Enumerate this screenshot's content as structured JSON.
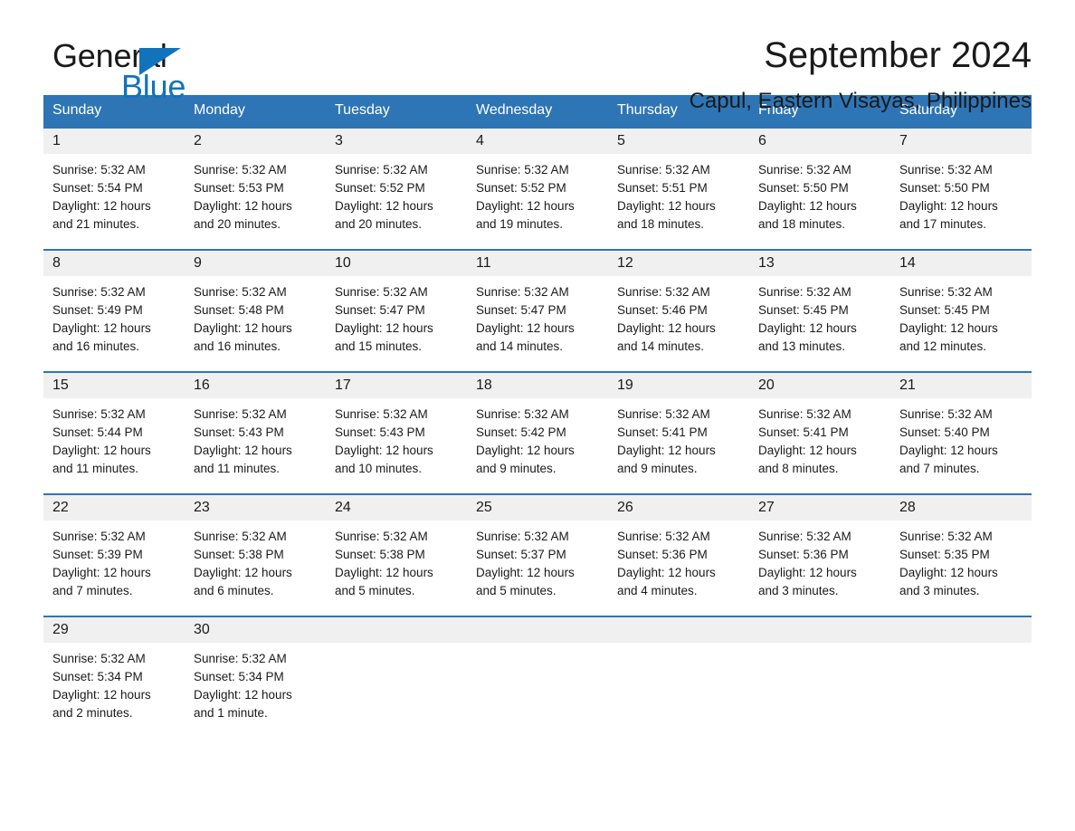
{
  "brand": {
    "name_part1": "General",
    "name_part2": "Blue",
    "logo_icon": "triangle-icon",
    "accent_color": "#1173bb"
  },
  "header": {
    "month_title": "September 2024",
    "location": "Capul, Eastern Visayas, Philippines"
  },
  "theme": {
    "header_blue": "#2e75b6",
    "daynum_gray": "#f0f0f0",
    "text": "#1a1a1a"
  },
  "calendar": {
    "weekday_headers": [
      "Sunday",
      "Monday",
      "Tuesday",
      "Wednesday",
      "Thursday",
      "Friday",
      "Saturday"
    ],
    "weeks": [
      [
        {
          "day": "1",
          "sunrise": "Sunrise: 5:32 AM",
          "sunset": "Sunset: 5:54 PM",
          "daylight_line1": "Daylight: 12 hours",
          "daylight_line2": "and 21 minutes."
        },
        {
          "day": "2",
          "sunrise": "Sunrise: 5:32 AM",
          "sunset": "Sunset: 5:53 PM",
          "daylight_line1": "Daylight: 12 hours",
          "daylight_line2": "and 20 minutes."
        },
        {
          "day": "3",
          "sunrise": "Sunrise: 5:32 AM",
          "sunset": "Sunset: 5:52 PM",
          "daylight_line1": "Daylight: 12 hours",
          "daylight_line2": "and 20 minutes."
        },
        {
          "day": "4",
          "sunrise": "Sunrise: 5:32 AM",
          "sunset": "Sunset: 5:52 PM",
          "daylight_line1": "Daylight: 12 hours",
          "daylight_line2": "and 19 minutes."
        },
        {
          "day": "5",
          "sunrise": "Sunrise: 5:32 AM",
          "sunset": "Sunset: 5:51 PM",
          "daylight_line1": "Daylight: 12 hours",
          "daylight_line2": "and 18 minutes."
        },
        {
          "day": "6",
          "sunrise": "Sunrise: 5:32 AM",
          "sunset": "Sunset: 5:50 PM",
          "daylight_line1": "Daylight: 12 hours",
          "daylight_line2": "and 18 minutes."
        },
        {
          "day": "7",
          "sunrise": "Sunrise: 5:32 AM",
          "sunset": "Sunset: 5:50 PM",
          "daylight_line1": "Daylight: 12 hours",
          "daylight_line2": "and 17 minutes."
        }
      ],
      [
        {
          "day": "8",
          "sunrise": "Sunrise: 5:32 AM",
          "sunset": "Sunset: 5:49 PM",
          "daylight_line1": "Daylight: 12 hours",
          "daylight_line2": "and 16 minutes."
        },
        {
          "day": "9",
          "sunrise": "Sunrise: 5:32 AM",
          "sunset": "Sunset: 5:48 PM",
          "daylight_line1": "Daylight: 12 hours",
          "daylight_line2": "and 16 minutes."
        },
        {
          "day": "10",
          "sunrise": "Sunrise: 5:32 AM",
          "sunset": "Sunset: 5:47 PM",
          "daylight_line1": "Daylight: 12 hours",
          "daylight_line2": "and 15 minutes."
        },
        {
          "day": "11",
          "sunrise": "Sunrise: 5:32 AM",
          "sunset": "Sunset: 5:47 PM",
          "daylight_line1": "Daylight: 12 hours",
          "daylight_line2": "and 14 minutes."
        },
        {
          "day": "12",
          "sunrise": "Sunrise: 5:32 AM",
          "sunset": "Sunset: 5:46 PM",
          "daylight_line1": "Daylight: 12 hours",
          "daylight_line2": "and 14 minutes."
        },
        {
          "day": "13",
          "sunrise": "Sunrise: 5:32 AM",
          "sunset": "Sunset: 5:45 PM",
          "daylight_line1": "Daylight: 12 hours",
          "daylight_line2": "and 13 minutes."
        },
        {
          "day": "14",
          "sunrise": "Sunrise: 5:32 AM",
          "sunset": "Sunset: 5:45 PM",
          "daylight_line1": "Daylight: 12 hours",
          "daylight_line2": "and 12 minutes."
        }
      ],
      [
        {
          "day": "15",
          "sunrise": "Sunrise: 5:32 AM",
          "sunset": "Sunset: 5:44 PM",
          "daylight_line1": "Daylight: 12 hours",
          "daylight_line2": "and 11 minutes."
        },
        {
          "day": "16",
          "sunrise": "Sunrise: 5:32 AM",
          "sunset": "Sunset: 5:43 PM",
          "daylight_line1": "Daylight: 12 hours",
          "daylight_line2": "and 11 minutes."
        },
        {
          "day": "17",
          "sunrise": "Sunrise: 5:32 AM",
          "sunset": "Sunset: 5:43 PM",
          "daylight_line1": "Daylight: 12 hours",
          "daylight_line2": "and 10 minutes."
        },
        {
          "day": "18",
          "sunrise": "Sunrise: 5:32 AM",
          "sunset": "Sunset: 5:42 PM",
          "daylight_line1": "Daylight: 12 hours",
          "daylight_line2": "and 9 minutes."
        },
        {
          "day": "19",
          "sunrise": "Sunrise: 5:32 AM",
          "sunset": "Sunset: 5:41 PM",
          "daylight_line1": "Daylight: 12 hours",
          "daylight_line2": "and 9 minutes."
        },
        {
          "day": "20",
          "sunrise": "Sunrise: 5:32 AM",
          "sunset": "Sunset: 5:41 PM",
          "daylight_line1": "Daylight: 12 hours",
          "daylight_line2": "and 8 minutes."
        },
        {
          "day": "21",
          "sunrise": "Sunrise: 5:32 AM",
          "sunset": "Sunset: 5:40 PM",
          "daylight_line1": "Daylight: 12 hours",
          "daylight_line2": "and 7 minutes."
        }
      ],
      [
        {
          "day": "22",
          "sunrise": "Sunrise: 5:32 AM",
          "sunset": "Sunset: 5:39 PM",
          "daylight_line1": "Daylight: 12 hours",
          "daylight_line2": "and 7 minutes."
        },
        {
          "day": "23",
          "sunrise": "Sunrise: 5:32 AM",
          "sunset": "Sunset: 5:38 PM",
          "daylight_line1": "Daylight: 12 hours",
          "daylight_line2": "and 6 minutes."
        },
        {
          "day": "24",
          "sunrise": "Sunrise: 5:32 AM",
          "sunset": "Sunset: 5:38 PM",
          "daylight_line1": "Daylight: 12 hours",
          "daylight_line2": "and 5 minutes."
        },
        {
          "day": "25",
          "sunrise": "Sunrise: 5:32 AM",
          "sunset": "Sunset: 5:37 PM",
          "daylight_line1": "Daylight: 12 hours",
          "daylight_line2": "and 5 minutes."
        },
        {
          "day": "26",
          "sunrise": "Sunrise: 5:32 AM",
          "sunset": "Sunset: 5:36 PM",
          "daylight_line1": "Daylight: 12 hours",
          "daylight_line2": "and 4 minutes."
        },
        {
          "day": "27",
          "sunrise": "Sunrise: 5:32 AM",
          "sunset": "Sunset: 5:36 PM",
          "daylight_line1": "Daylight: 12 hours",
          "daylight_line2": "and 3 minutes."
        },
        {
          "day": "28",
          "sunrise": "Sunrise: 5:32 AM",
          "sunset": "Sunset: 5:35 PM",
          "daylight_line1": "Daylight: 12 hours",
          "daylight_line2": "and 3 minutes."
        }
      ],
      [
        {
          "day": "29",
          "sunrise": "Sunrise: 5:32 AM",
          "sunset": "Sunset: 5:34 PM",
          "daylight_line1": "Daylight: 12 hours",
          "daylight_line2": "and 2 minutes."
        },
        {
          "day": "30",
          "sunrise": "Sunrise: 5:32 AM",
          "sunset": "Sunset: 5:34 PM",
          "daylight_line1": "Daylight: 12 hours",
          "daylight_line2": "and 1 minute."
        },
        {
          "day": "",
          "sunrise": "",
          "sunset": "",
          "daylight_line1": "",
          "daylight_line2": ""
        },
        {
          "day": "",
          "sunrise": "",
          "sunset": "",
          "daylight_line1": "",
          "daylight_line2": ""
        },
        {
          "day": "",
          "sunrise": "",
          "sunset": "",
          "daylight_line1": "",
          "daylight_line2": ""
        },
        {
          "day": "",
          "sunrise": "",
          "sunset": "",
          "daylight_line1": "",
          "daylight_line2": ""
        },
        {
          "day": "",
          "sunrise": "",
          "sunset": "",
          "daylight_line1": "",
          "daylight_line2": ""
        }
      ]
    ]
  }
}
